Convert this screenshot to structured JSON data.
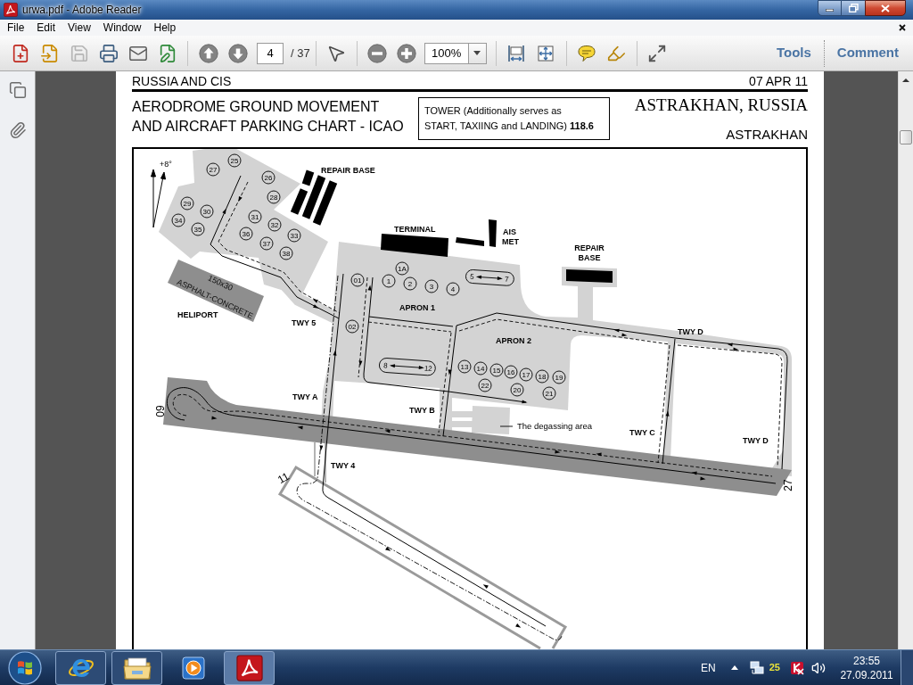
{
  "window": {
    "title": "urwa.pdf - Adobe Reader"
  },
  "menu": {
    "items": [
      "File",
      "Edit",
      "View",
      "Window",
      "Help"
    ]
  },
  "toolbar": {
    "groups": [
      [
        {
          "kind": "create",
          "disabled": false
        },
        {
          "kind": "export",
          "disabled": false
        },
        {
          "kind": "save",
          "disabled": true
        },
        {
          "kind": "print",
          "disabled": false
        },
        {
          "kind": "email",
          "disabled": false
        },
        {
          "kind": "sign",
          "disabled": false
        }
      ],
      [
        {
          "kind": "prev_page",
          "disabled": false
        },
        {
          "kind": "next_page",
          "disabled": false
        },
        {
          "kind": "page_field",
          "value": "4",
          "total": "/ 37"
        }
      ],
      [
        {
          "kind": "select",
          "disabled": false
        }
      ],
      [
        {
          "kind": "zoom_out",
          "disabled": false
        },
        {
          "kind": "zoom_in",
          "disabled": false
        },
        {
          "kind": "zoom_field",
          "value": "100%"
        }
      ],
      [
        {
          "kind": "fit_width",
          "disabled": false
        },
        {
          "kind": "fit_page",
          "disabled": false
        }
      ],
      [
        {
          "kind": "comment",
          "disabled": false
        },
        {
          "kind": "highlight",
          "disabled": false
        }
      ],
      [
        {
          "kind": "full_screen",
          "disabled": false
        }
      ]
    ],
    "panels": [
      "Tools",
      "Comment"
    ]
  },
  "nav_pane": [
    {
      "kind": "pages"
    },
    {
      "kind": "attachments"
    }
  ],
  "page": {
    "header": {
      "region": "RUSSIA AND CIS",
      "date": "07 APR 11",
      "title_lines": [
        "AERODROME GROUND MOVEMENT",
        "AND AIRCRAFT PARKING CHART - ICAO"
      ],
      "frequency_lines": [
        "TOWER (Additionally serves as",
        "START, TAXIING and LANDING) **118.6**"
      ],
      "location": "ASTRAKHAN, RUSSIA",
      "airport": "ASTRAKHAN"
    },
    "chart": {
      "variation": "+8°",
      "labels": [
        {
          "kind": "building",
          "text": "REPAIR BASE"
        },
        {
          "kind": "building",
          "text": "TERMINAL"
        },
        {
          "kind": "building",
          "text": "AIS"
        },
        {
          "kind": "building",
          "text": "MET"
        },
        {
          "kind": "building",
          "text": "REPAIR"
        },
        {
          "kind": "building",
          "text": "BASE"
        },
        {
          "kind": "area",
          "text": "HELIPORT"
        },
        {
          "kind": "apron",
          "text": "APRON 1"
        },
        {
          "kind": "apron",
          "text": "APRON 2"
        },
        {
          "kind": "taxiway",
          "text": "TWY 5"
        },
        {
          "kind": "taxiway",
          "text": "TWY A"
        },
        {
          "kind": "taxiway",
          "text": "TWY B"
        },
        {
          "kind": "taxiway",
          "text": "TWY D"
        },
        {
          "kind": "taxiway",
          "text": "TWY C"
        },
        {
          "kind": "taxiway",
          "text": "TWY D"
        },
        {
          "kind": "taxiway",
          "text": "TWY 4"
        },
        {
          "kind": "note",
          "text": "The degassing area"
        }
      ],
      "heliport_surface": [
        "150x30",
        "ASPHALT-CONCRETE"
      ],
      "stands": [
        "25",
        "27",
        "26",
        "28",
        "29",
        "30",
        "34",
        "35",
        "31",
        "32",
        "33",
        "36",
        "37",
        "38",
        "1A",
        "01",
        "1",
        "2",
        "3",
        "4",
        "02",
        "13",
        "14",
        "15",
        "16",
        "17",
        "18",
        "19",
        "22",
        "20",
        "21"
      ],
      "stand_ranges": [
        {
          "from": "5",
          "to": "7"
        },
        {
          "from": "8",
          "to": "12"
        }
      ],
      "runway_designators": [
        "09",
        "27",
        "11"
      ]
    }
  },
  "taskbar": {
    "apps": [
      {
        "kind": "browser",
        "running": true,
        "selected": false
      },
      {
        "kind": "folder",
        "running": true,
        "selected": false
      },
      {
        "kind": "media",
        "running": false,
        "selected": false
      },
      {
        "kind": "pdf",
        "running": true,
        "selected": true
      }
    ],
    "language": "EN",
    "tray_badge": "25",
    "time": "23:55",
    "date": "27.09.2011"
  }
}
